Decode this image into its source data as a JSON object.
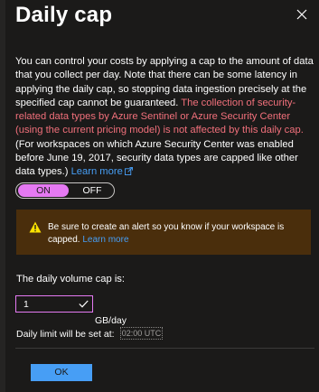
{
  "header": {
    "title": "Daily cap"
  },
  "description": {
    "part1": "You can control your costs by applying a cap to the amount of data that you collect per day. Note that there can be some latency in applying the daily cap, so stopping data ingestion precisely at the specified cap cannot be guaranteed. ",
    "warning": "The collection of security-related data types by Azure Sentinel or Azure Security Center (using the current pricing model) is not affected by this daily cap.",
    "part2": "  (For workspaces on which Azure Security Center was enabled before June 19, 2017, security data types are capped like other data types.) ",
    "learn_more": "Learn more"
  },
  "toggle": {
    "on_label": "ON",
    "off_label": "OFF",
    "selected": "ON"
  },
  "alert": {
    "text": "Be sure to create an alert so you know if your workspace is capped. ",
    "link": "Learn more"
  },
  "cap": {
    "label": "The daily volume cap is:",
    "value": "1",
    "unit": "GB/day",
    "limit_label": "Daily limit will be set at:",
    "limit_time": "02:00 UTC"
  },
  "footer": {
    "ok_label": "OK"
  },
  "colors": {
    "background": "#1b1a19",
    "accent": "#e579f2",
    "link": "#479ef5",
    "warning_text": "#f1707b",
    "alert_background": "#4a2e0c",
    "warning_icon": "#fce100"
  }
}
